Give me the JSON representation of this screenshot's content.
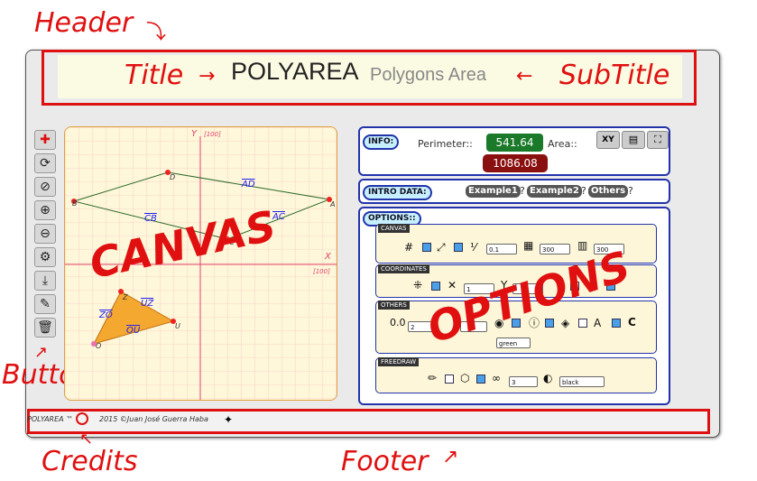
{
  "annotations": {
    "header": "Header",
    "title": "Title",
    "subtitle_label": "SubTitle",
    "canvas": "CANVAS",
    "options": "OPTIONS",
    "buttons": "Buttons",
    "credits": "Credits",
    "footer": "Footer"
  },
  "app": {
    "title": "POLYAREA",
    "subtitle": "Polygons Area"
  },
  "toolbar": {
    "icons": [
      "plus-icon",
      "refresh-icon",
      "zoom-reset-icon",
      "zoom-in-icon",
      "zoom-out-icon",
      "gear-icon",
      "download-icon",
      "brush-icon",
      "trash-icon"
    ]
  },
  "canvas": {
    "axis_x": "X",
    "axis_y": "Y",
    "x_max": "[100]",
    "y_max": "[100]",
    "points": [
      "A",
      "B",
      "C",
      "D",
      "U",
      "Z",
      "O"
    ],
    "segments": [
      "AD",
      "CB",
      "AC",
      "UZ",
      "ZO",
      "OU"
    ]
  },
  "info": {
    "label": "INFO:",
    "perimeter_label": "Perimeter::",
    "perimeter_value": "541.64",
    "area_label": "Area::",
    "area_value": "1086.08",
    "buttons": [
      "XY"
    ]
  },
  "intro": {
    "label": "INTRO DATA:",
    "examples": [
      "Example1",
      "Example2",
      "Others"
    ],
    "q": "?"
  },
  "options": {
    "label": "OPTIONS::",
    "canvas": {
      "label": "CANVAS",
      "v1": "0.1",
      "v2": "300",
      "v3": "300"
    },
    "coordinates": {
      "label": "COORDINATES",
      "v1": "1"
    },
    "others": {
      "label": "OTHERS",
      "decimals_label": "0.0",
      "v1": "2",
      "color": "green",
      "c_label": "C"
    },
    "freedraw": {
      "label": "FREEDRAW",
      "v1": "3",
      "color": "black"
    }
  },
  "footer": {
    "credits": "POLYAREA ™",
    "copyright": "2015 ©Juan José Guerra Haba"
  }
}
